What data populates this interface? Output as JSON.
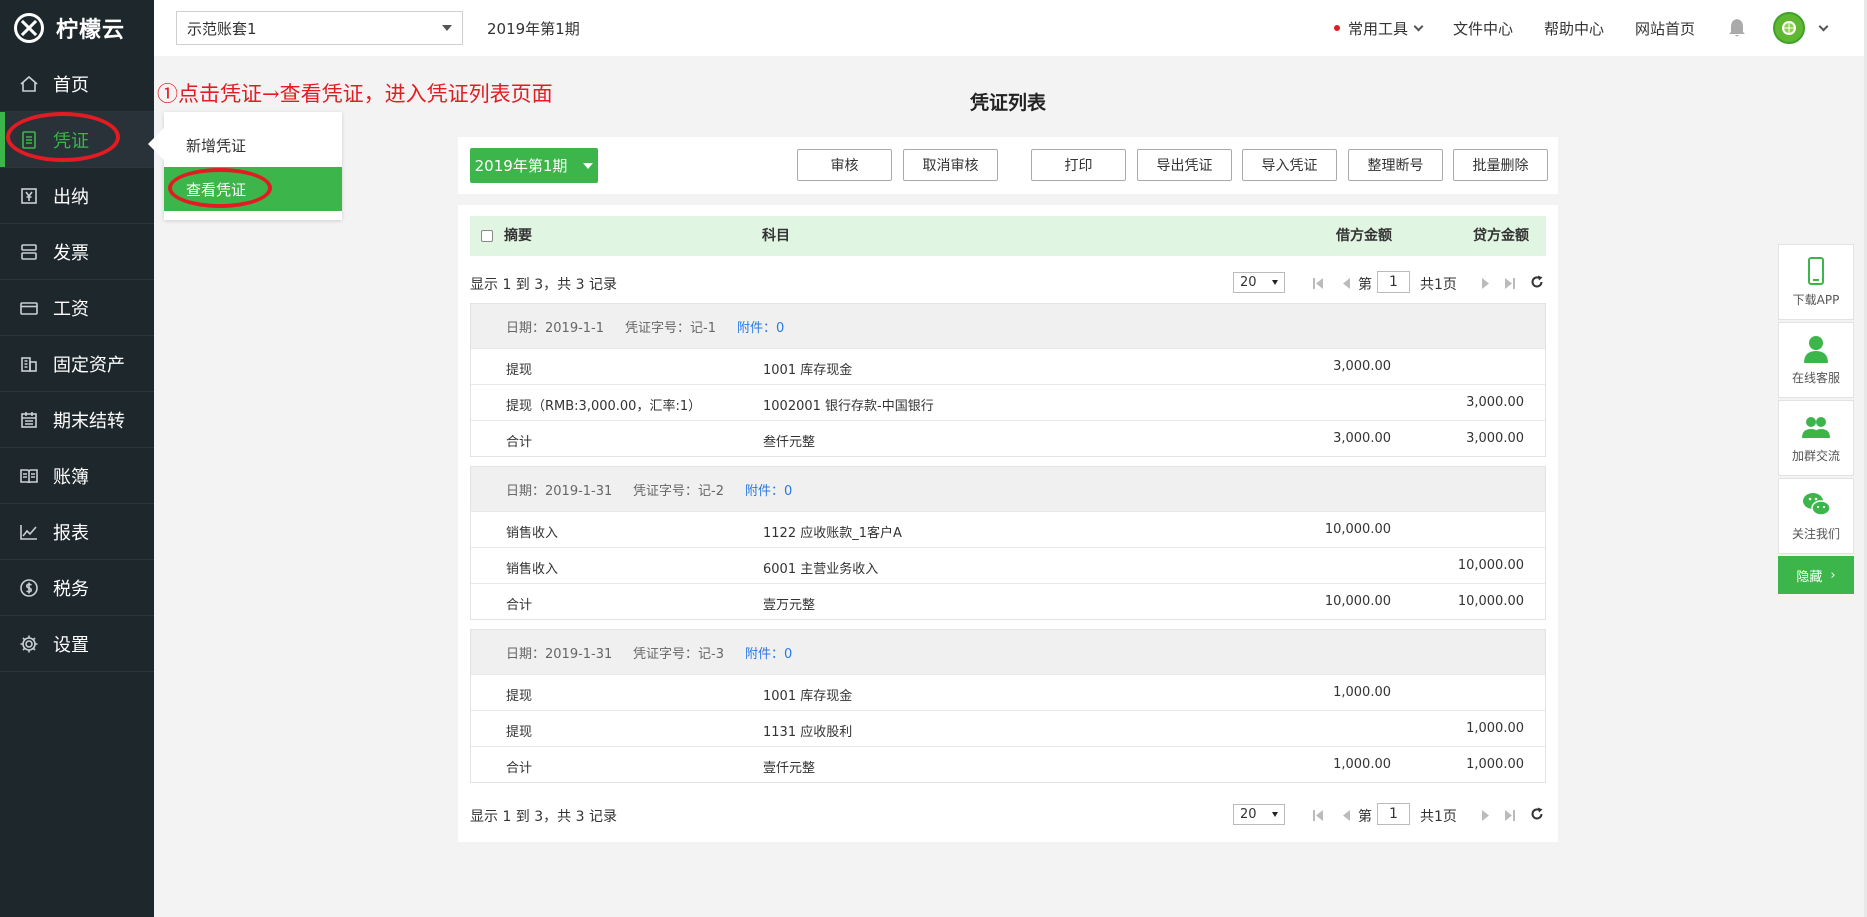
{
  "app": {
    "name": "柠檬云",
    "account_set": "示范账套1",
    "period": "2019年第1期"
  },
  "sidebar": {
    "items": [
      {
        "label": "首页",
        "icon": "home-icon"
      },
      {
        "label": "凭证",
        "icon": "voucher-icon"
      },
      {
        "label": "出纳",
        "icon": "cashier-icon"
      },
      {
        "label": "发票",
        "icon": "invoice-icon"
      },
      {
        "label": "工资",
        "icon": "salary-card-icon"
      },
      {
        "label": "固定资产",
        "icon": "building-icon"
      },
      {
        "label": "期末结转",
        "icon": "calendar-icon"
      },
      {
        "label": "账簿",
        "icon": "book-icon"
      },
      {
        "label": "报表",
        "icon": "chart-icon"
      },
      {
        "label": "税务",
        "icon": "tax-coin-icon"
      },
      {
        "label": "设置",
        "icon": "gear-icon"
      }
    ],
    "active": "凭证"
  },
  "topbar": {
    "tools": "常用工具",
    "files": "文件中心",
    "help": "帮助中心",
    "website": "网站首页",
    "notification_dot_color": "#e21c22"
  },
  "submenu": {
    "new_voucher": "新增凭证",
    "view_voucher": "查看凭证"
  },
  "annotation": "①点击凭证→查看凭证，进入凭证列表页面",
  "main": {
    "title": "凭证列表",
    "period_button": "2019年第1期",
    "toolbar": {
      "audit": "审核",
      "cancel_audit": "取消审核",
      "print": "打印",
      "export": "导出凭证",
      "import": "导入凭证",
      "reorder": "整理断号",
      "batch_delete": "批量删除"
    },
    "columns": {
      "summary": "摘要",
      "subject": "科目",
      "debit": "借方金额",
      "credit": "贷方金额"
    },
    "pager": {
      "info": "显示 1 到 3，共 3 记录",
      "page_size": "20",
      "page_label": "第",
      "page": "1",
      "total_pages": "共1页"
    },
    "vouchers": [
      {
        "date": "日期：2019-1-1",
        "number": "凭证字号：记-1",
        "attachments": "附件：0",
        "rows": [
          {
            "summary": "提现",
            "subject": "1001 库存现金",
            "debit": "3,000.00",
            "credit": ""
          },
          {
            "summary": "提现（RMB:3,000.00，汇率:1）",
            "subject": "1002001 银行存款-中国银行",
            "debit": "",
            "credit": "3,000.00"
          },
          {
            "summary": "合计",
            "subject": "叁仟元整",
            "debit": "3,000.00",
            "credit": "3,000.00"
          }
        ]
      },
      {
        "date": "日期：2019-1-31",
        "number": "凭证字号：记-2",
        "attachments": "附件：0",
        "rows": [
          {
            "summary": "销售收入",
            "subject": "1122 应收账款_1客户A",
            "debit": "10,000.00",
            "credit": ""
          },
          {
            "summary": "销售收入",
            "subject": "6001 主营业务收入",
            "debit": "",
            "credit": "10,000.00"
          },
          {
            "summary": "合计",
            "subject": "壹万元整",
            "debit": "10,000.00",
            "credit": "10,000.00"
          }
        ]
      },
      {
        "date": "日期：2019-1-31",
        "number": "凭证字号：记-3",
        "attachments": "附件：0",
        "rows": [
          {
            "summary": "提现",
            "subject": "1001 库存现金",
            "debit": "1,000.00",
            "credit": ""
          },
          {
            "summary": "提现",
            "subject": "1131 应收股利",
            "debit": "",
            "credit": "1,000.00"
          },
          {
            "summary": "合计",
            "subject": "壹仟元整",
            "debit": "1,000.00",
            "credit": "1,000.00"
          }
        ]
      }
    ]
  },
  "float_panel": {
    "download_app": "下载APP",
    "online_service": "在线客服",
    "join_group": "加群交流",
    "follow_us": "关注我们",
    "hide": "隐藏"
  },
  "colors": {
    "brand_green": "#3cb64a",
    "sidebar_bg": "#1e272c",
    "annotation_red": "#e21c22",
    "link_blue": "#2a7ae2"
  }
}
